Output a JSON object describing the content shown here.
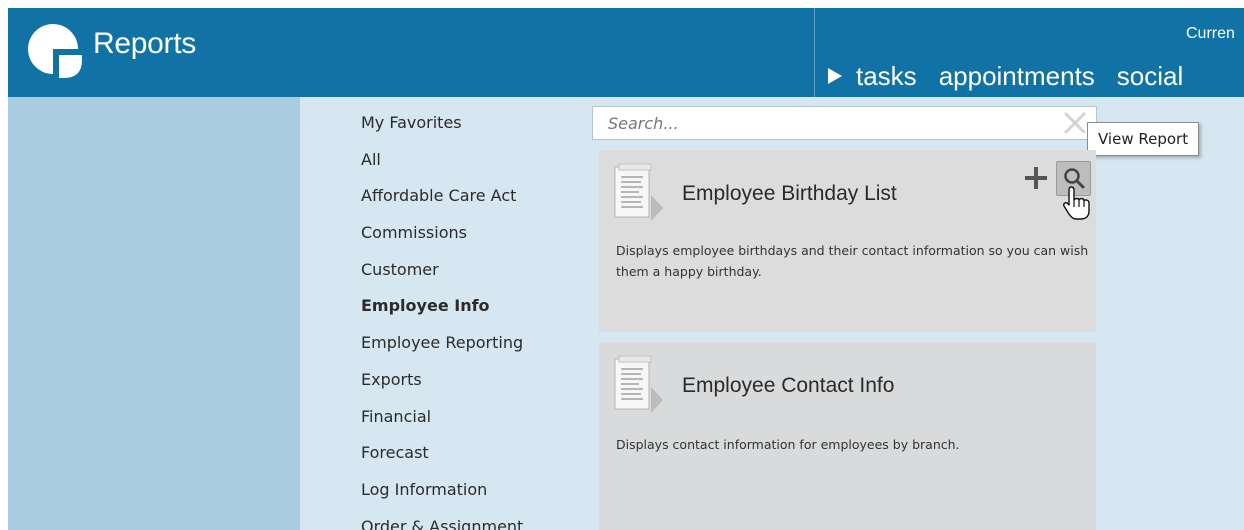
{
  "header": {
    "app_title": "Reports",
    "current_label": "Curren",
    "tabs": [
      "tasks",
      "appointments",
      "social"
    ],
    "logo_icon": "reports-logo-icon",
    "colors": {
      "header_bg": "#1172a6",
      "left_panel": "#a9cce0",
      "main_bg": "#d6e7f1"
    }
  },
  "sidebar": {
    "items": [
      {
        "label": "My Favorites"
      },
      {
        "label": "All"
      },
      {
        "label": "Affordable Care Act"
      },
      {
        "label": "Commissions"
      },
      {
        "label": "Customer"
      },
      {
        "label": "Employee Info",
        "active": true
      },
      {
        "label": "Employee Reporting"
      },
      {
        "label": "Exports"
      },
      {
        "label": "Financial"
      },
      {
        "label": "Forecast"
      },
      {
        "label": "Log Information"
      },
      {
        "label": "Order & Assignment"
      }
    ]
  },
  "search": {
    "placeholder": "Search...",
    "value": ""
  },
  "tooltip": {
    "text": "View Report"
  },
  "reports": [
    {
      "title": "Employee Birthday List",
      "description": "Displays employee birthdays and their contact information so you can wish them a happy birthday."
    },
    {
      "title": "Employee Contact Info",
      "description": "Displays contact information for employees by branch."
    }
  ],
  "icons": {
    "report": "report-document-icon",
    "add": "plus-icon",
    "view": "magnifier-icon",
    "clear": "close-icon",
    "cursor": "hand-pointer-icon"
  }
}
